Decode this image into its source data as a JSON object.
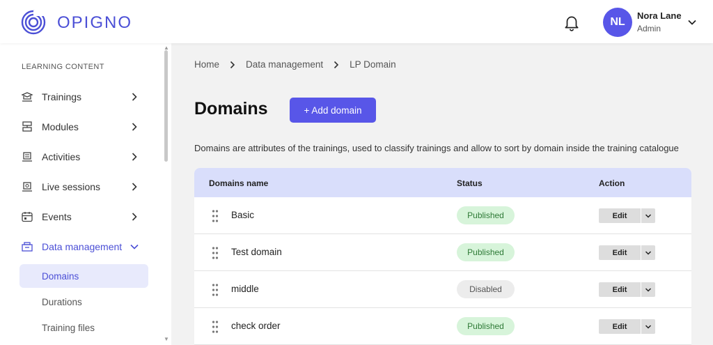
{
  "header": {
    "logo_text": "OPIGNO",
    "user": {
      "initials": "NL",
      "name": "Nora Lane",
      "role": "Admin"
    }
  },
  "sidebar": {
    "section_title": "LEARNING CONTENT",
    "items": [
      {
        "label": "Trainings",
        "icon": "trainings-icon"
      },
      {
        "label": "Modules",
        "icon": "modules-icon"
      },
      {
        "label": "Activities",
        "icon": "activities-icon"
      },
      {
        "label": "Live sessions",
        "icon": "live-sessions-icon"
      },
      {
        "label": "Events",
        "icon": "calendar-icon"
      },
      {
        "label": "Data management",
        "icon": "data-management-icon",
        "expanded": true
      }
    ],
    "subitems": [
      {
        "label": "Domains",
        "active": true
      },
      {
        "label": "Durations",
        "active": false
      },
      {
        "label": "Training files",
        "active": false
      }
    ]
  },
  "breadcrumb": [
    "Home",
    "Data management",
    "LP Domain"
  ],
  "page": {
    "title": "Domains",
    "add_button": "+ Add domain",
    "description": "Domains are attributes of the trainings, used to classify trainings and allow to sort by domain inside the training catalogue"
  },
  "table": {
    "columns": [
      "Domains name",
      "Status",
      "Action"
    ],
    "rows": [
      {
        "name": "Basic",
        "status": "Published",
        "action": "Edit"
      },
      {
        "name": "Test domain",
        "status": "Published",
        "action": "Edit"
      },
      {
        "name": "middle",
        "status": "Disabled",
        "action": "Edit"
      },
      {
        "name": "check order",
        "status": "Published",
        "action": "Edit"
      }
    ]
  },
  "colors": {
    "accent": "#5856e8",
    "table_header": "#d9defb",
    "published_bg": "#d7f4da",
    "disabled_bg": "#ececec"
  }
}
